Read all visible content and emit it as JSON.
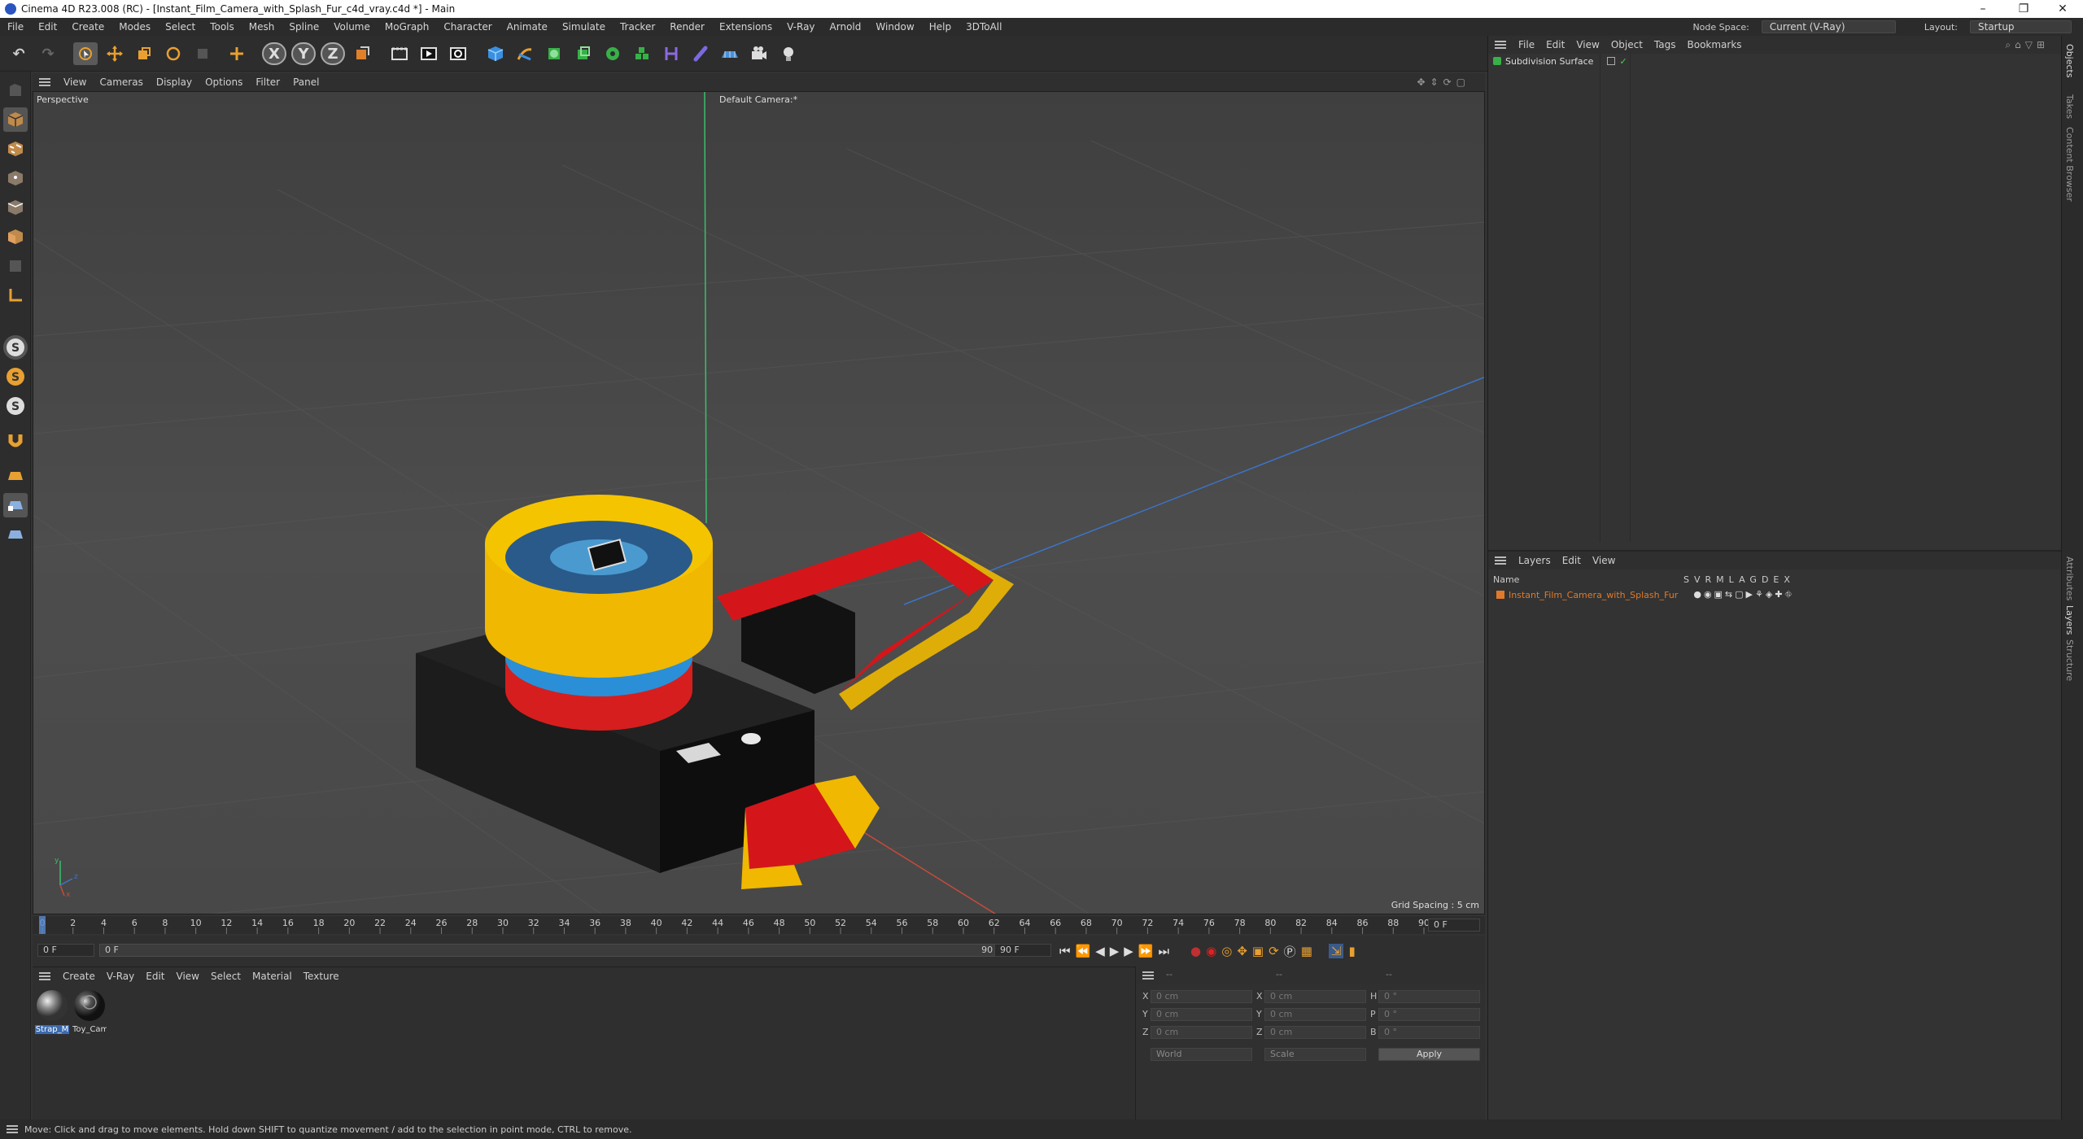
{
  "window": {
    "title": "Cinema 4D R23.008 (RC) - [Instant_Film_Camera_with_Splash_Fur_c4d_vray.c4d *] - Main",
    "min": "–",
    "max": "❐",
    "close": "✕"
  },
  "menubar": {
    "items": [
      "File",
      "Edit",
      "Create",
      "Modes",
      "Select",
      "Tools",
      "Mesh",
      "Spline",
      "Volume",
      "MoGraph",
      "Character",
      "Animate",
      "Simulate",
      "Tracker",
      "Render",
      "Extensions",
      "V-Ray",
      "Arnold",
      "Window",
      "Help",
      "3DToAll"
    ],
    "node_space_label": "Node Space:",
    "node_space_value": "Current (V-Ray)",
    "layout_label": "Layout:",
    "layout_value": "Startup"
  },
  "toolbar": {
    "x_label": "X",
    "y_label": "Y",
    "z_label": "Z"
  },
  "lefttools": {
    "s1": "S",
    "s2": "S",
    "s3": "S"
  },
  "viewport": {
    "menu": [
      "View",
      "Cameras",
      "Display",
      "Options",
      "Filter",
      "Panel"
    ],
    "view_name": "Perspective",
    "camera_name": "Default Camera",
    "camera_marker": ":*",
    "grid_spacing": "Grid Spacing : 5 cm",
    "axis_y": "y",
    "axis_z": "z",
    "axis_x": "x",
    "colors": {
      "y_axis": "#3bbf6a",
      "x_axis": "#c84a3a",
      "z_axis": "#3c74c8"
    }
  },
  "timeline": {
    "ticks": [
      "0",
      "2",
      "4",
      "6",
      "8",
      "10",
      "12",
      "14",
      "16",
      "18",
      "20",
      "22",
      "24",
      "26",
      "28",
      "30",
      "32",
      "34",
      "36",
      "38",
      "40",
      "42",
      "44",
      "46",
      "48",
      "50",
      "52",
      "54",
      "56",
      "58",
      "60",
      "62",
      "64",
      "66",
      "68",
      "70",
      "72",
      "74",
      "76",
      "78",
      "80",
      "82",
      "84",
      "86",
      "88",
      "90"
    ],
    "current_frame": "0 F"
  },
  "transport": {
    "start_field": "0 F",
    "range_start": "0 F",
    "range_end": "90 F",
    "end_field": "90 F"
  },
  "materials": {
    "menu": [
      "Create",
      "V-Ray",
      "Edit",
      "View",
      "Select",
      "Material",
      "Texture"
    ],
    "items": [
      {
        "name": "Strap_M"
      },
      {
        "name": "Toy_Cam"
      }
    ]
  },
  "coordinates": {
    "headers": [
      "--",
      "--",
      "--"
    ],
    "rows": [
      {
        "a": "X",
        "av": "0 cm",
        "b": "X",
        "bv": "0 cm",
        "c": "H",
        "cv": "0 °"
      },
      {
        "a": "Y",
        "av": "0 cm",
        "b": "Y",
        "bv": "0 cm",
        "c": "P",
        "cv": "0 °"
      },
      {
        "a": "Z",
        "av": "0 cm",
        "b": "Z",
        "bv": "0 cm",
        "c": "B",
        "cv": "0 °"
      }
    ],
    "world": "World",
    "scale": "Scale",
    "apply": "Apply"
  },
  "objects": {
    "menu": [
      "File",
      "Edit",
      "View",
      "Object",
      "Tags",
      "Bookmarks"
    ],
    "item": "Subdivision Surface"
  },
  "layers": {
    "menu": [
      "Layers",
      "Edit",
      "View"
    ],
    "name_header": "Name",
    "cols": [
      "S",
      "V",
      "R",
      "M",
      "L",
      "A",
      "G",
      "D",
      "E",
      "X"
    ],
    "item": "Instant_Film_Camera_with_Splash_Fur",
    "item_color": "#e07a2a"
  },
  "right_tabs": [
    "Objects",
    "Takes",
    "Content Browser",
    "Attributes",
    "Layers",
    "Structure"
  ],
  "status": {
    "text": "Move: Click and drag to move elements. Hold down SHIFT to quantize movement / add to the selection in point mode, CTRL to remove."
  }
}
